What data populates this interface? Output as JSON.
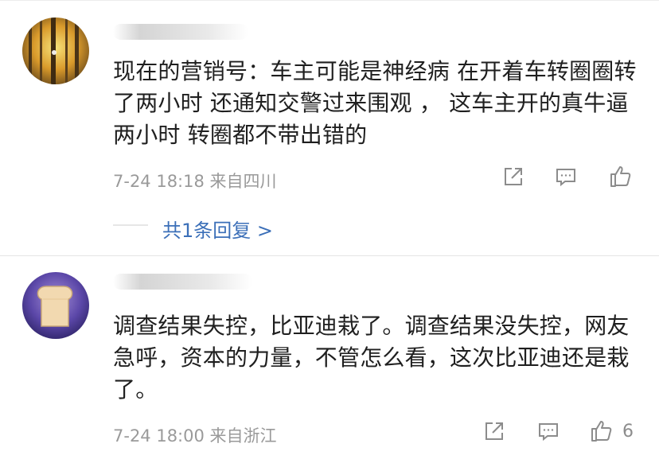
{
  "comments": [
    {
      "text": "现在的营销号：车主可能是神经病 在开着车转圈圈转了两小时 还通知交警过来围观 ， 这车主开的真牛逼 两小时 转圈都不带出错的",
      "time": "7-24 18:18",
      "location": "来自四川",
      "likes": "",
      "replies": "共1条回复 >"
    },
    {
      "text": "调查结果失控，比亚迪栽了。调查结果没失控，网友急呼，资本的力量，不管怎么看，这次比亚迪还是栽了。",
      "time": "7-24 18:00",
      "location": "来自浙江",
      "likes": "6",
      "avatar_caption": "アンパンマン"
    }
  ],
  "colors": {
    "meta_gray": "#9a9a9a",
    "reply_link": "#3b6fb8",
    "icon_gray": "#8c8c8c"
  }
}
